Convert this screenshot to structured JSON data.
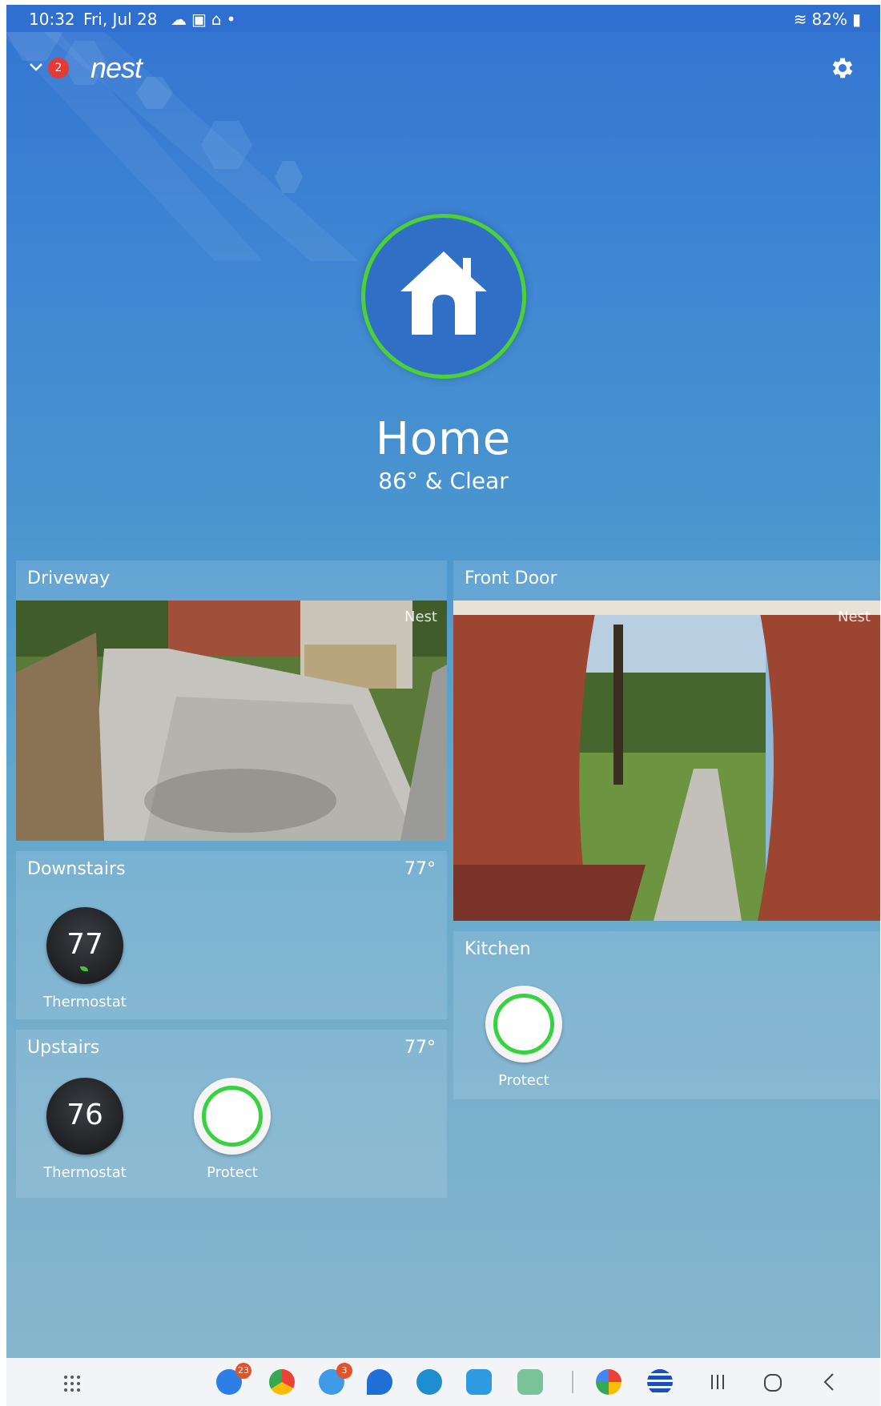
{
  "status_bar": {
    "time": "10:32",
    "date": "Fri, Jul 28",
    "battery": "82%"
  },
  "header": {
    "logo": "nest",
    "notification_count": "2"
  },
  "home": {
    "title": "Home",
    "weather": "86° & Clear"
  },
  "cards": {
    "driveway": {
      "title": "Driveway",
      "watermark": "Nest"
    },
    "front_door": {
      "title": "Front Door",
      "watermark": "Nest"
    },
    "downstairs": {
      "title": "Downstairs",
      "temp": "77°",
      "thermostat_value": "77",
      "thermostat_label": "Thermostat"
    },
    "upstairs": {
      "title": "Upstairs",
      "temp": "77°",
      "thermostat_value": "76",
      "thermostat_label": "Thermostat",
      "protect_label": "Protect"
    },
    "kitchen": {
      "title": "Kitchen",
      "protect_label": "Protect"
    }
  },
  "dock": {
    "badges": {
      "app1": "23",
      "home_app": "3"
    }
  },
  "colors": {
    "accent_green": "#4cd137",
    "sky_top": "#3274d2",
    "sky_bottom": "#86b6cd"
  }
}
